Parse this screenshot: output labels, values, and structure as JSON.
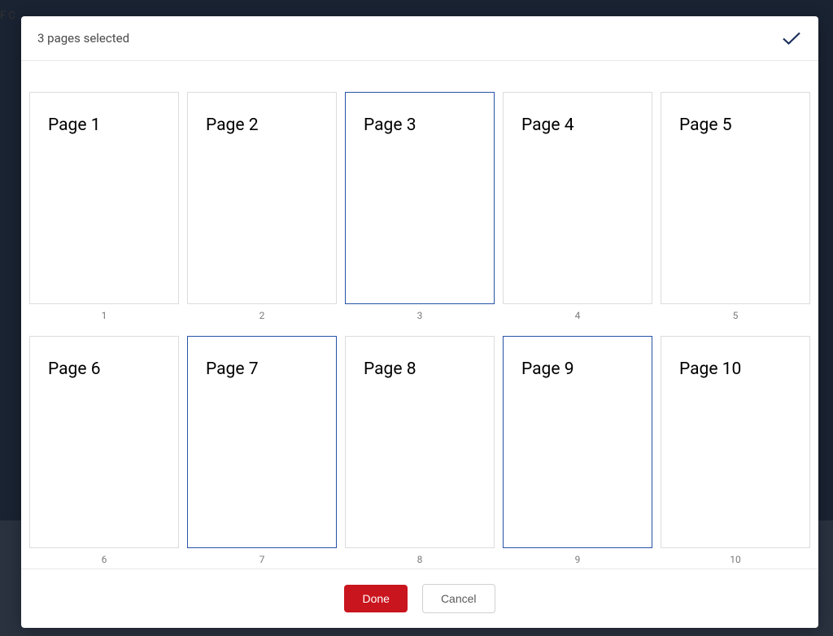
{
  "background": {
    "partial_text": "F C"
  },
  "header": {
    "title": "3 pages selected"
  },
  "pages": [
    {
      "label": "Page 1",
      "number": "1",
      "selected": false
    },
    {
      "label": "Page 2",
      "number": "2",
      "selected": false
    },
    {
      "label": "Page 3",
      "number": "3",
      "selected": true
    },
    {
      "label": "Page 4",
      "number": "4",
      "selected": false
    },
    {
      "label": "Page 5",
      "number": "5",
      "selected": false
    },
    {
      "label": "Page 6",
      "number": "6",
      "selected": false
    },
    {
      "label": "Page 7",
      "number": "7",
      "selected": true
    },
    {
      "label": "Page 8",
      "number": "8",
      "selected": false
    },
    {
      "label": "Page 9",
      "number": "9",
      "selected": true
    },
    {
      "label": "Page 10",
      "number": "10",
      "selected": false
    }
  ],
  "footer": {
    "done_label": "Done",
    "cancel_label": "Cancel"
  }
}
